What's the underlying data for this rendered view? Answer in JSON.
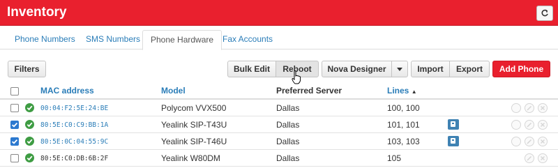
{
  "header": {
    "title": "Inventory",
    "refresh_icon": "refresh-icon"
  },
  "tabs": [
    {
      "label": "Phone Numbers",
      "active": false
    },
    {
      "label": "SMS Numbers",
      "active": false
    },
    {
      "label": "Phone Hardware",
      "active": true
    },
    {
      "label": "Fax Accounts",
      "active": false
    }
  ],
  "toolbar": {
    "filters": "Filters",
    "bulk_edit": "Bulk Edit",
    "reboot": "Reboot",
    "nova_designer": "Nova Designer",
    "import": "Import",
    "export": "Export",
    "add_phone": "Add Phone"
  },
  "table": {
    "columns": {
      "mac": "MAC address",
      "model": "Model",
      "server": "Preferred Server",
      "lines": "Lines"
    },
    "sort_indicator": "▲",
    "rows": [
      {
        "checked": false,
        "mac": "00:04:F2:5E:24:BE",
        "model": "Polycom VVX500",
        "server": "Dallas",
        "lines": "100, 100",
        "badge": false
      },
      {
        "checked": true,
        "mac": "80:5E:C0:C9:BB:1A",
        "model": "Yealink SIP-T43U",
        "server": "Dallas",
        "lines": "101, 101",
        "badge": true
      },
      {
        "checked": true,
        "mac": "80:5E:0C:04:55:9C",
        "model": "Yealink SIP-T46U",
        "server": "Dallas",
        "lines": "103, 103",
        "badge": true
      },
      {
        "checked": false,
        "mac": "80:5E:C0:DB:6B:2F",
        "model": "Yealink W80DM",
        "server": "Dallas",
        "lines": "105",
        "badge": false
      }
    ]
  },
  "colors": {
    "brand": "#e9202e",
    "link": "#2a7db8",
    "ok": "#3e9c43",
    "checkbox": "#2c79cf"
  }
}
